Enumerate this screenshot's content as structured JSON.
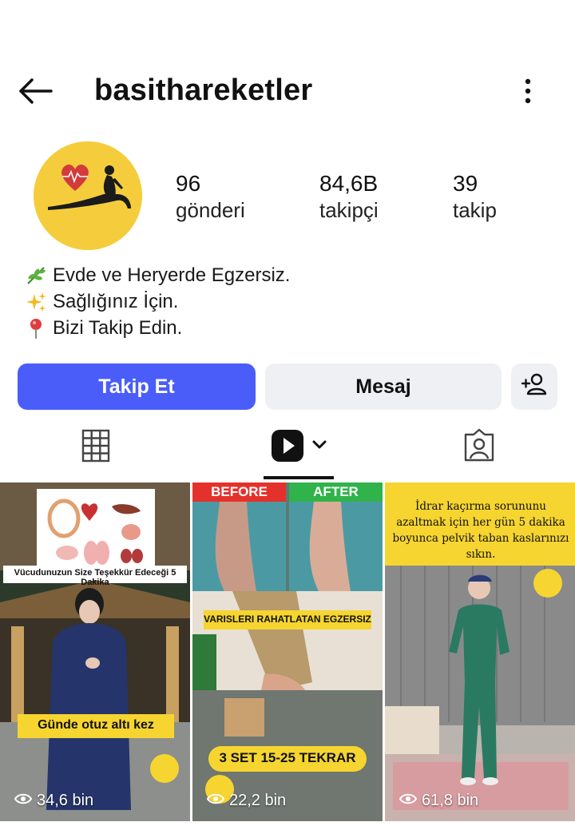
{
  "header": {
    "username": "basithareketler"
  },
  "stats": {
    "posts": {
      "value": "96",
      "label": "gönderi"
    },
    "followers": {
      "value": "84,6B",
      "label": "takipçi"
    },
    "following": {
      "value": "39",
      "label": "takip"
    }
  },
  "bio": [
    {
      "icon": "herb-icon",
      "text": "Evde ve Heryerde Egzersiz."
    },
    {
      "icon": "sparkles-icon",
      "text": "Sağlığınız İçin."
    },
    {
      "icon": "pin-icon",
      "text": "Bizi Takip Edin."
    }
  ],
  "actions": {
    "follow_label": "Takip Et",
    "message_label": "Mesaj",
    "add_person_icon": "add-person-icon"
  },
  "tabs": {
    "grid_icon": "grid-icon",
    "reels_icon": "reels-icon",
    "tagged_icon": "tagged-icon"
  },
  "reels": [
    {
      "caption_top": "Vücudunuzun Size Teşekkür Edeceği 5 Dakika",
      "caption_mid": "Günde otuz altı kez",
      "views": "34,6 bin"
    },
    {
      "label_before": "BEFORE",
      "label_after": "AFTER",
      "caption_mid": "VARISLERI RAHATLATAN EGZERSIZ",
      "caption_bottom": "3 SET 15-25 TEKRAR",
      "views": "22,2 bin"
    },
    {
      "caption_top": "İdrar kaçırma sorununu azaltmak için her gün 5 dakika boyunca pelvik taban kaslarınızı sıkın.",
      "views": "61,8 bin"
    }
  ],
  "colors": {
    "follow_button": "#4a5df9",
    "secondary_button": "#eff0f4",
    "avatar_bg": "#f5cd3c"
  }
}
